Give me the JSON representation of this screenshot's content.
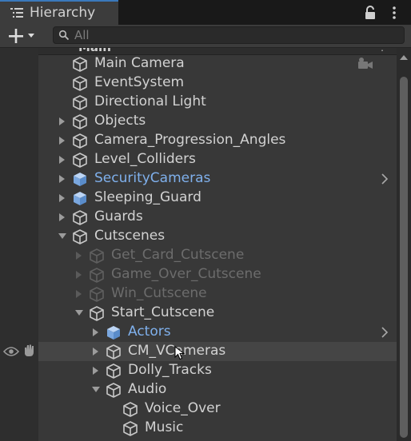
{
  "window": {
    "tab_title": "Hierarchy"
  },
  "toolbar": {
    "search_placeholder": "All"
  },
  "scene": {
    "name": "Main"
  },
  "colors": {
    "prefab_text": "#7fb0ec",
    "disabled_text": "#6c6c6c",
    "normal_text": "#d2d2d2",
    "accent": "#3a79bb"
  },
  "rows": [
    {
      "label": "Main Camera",
      "depth": 0,
      "arrow": "none",
      "icon": "gameobject-icon",
      "state": "normal"
    },
    {
      "label": "EventSystem",
      "depth": 0,
      "arrow": "none",
      "icon": "gameobject-icon",
      "state": "normal"
    },
    {
      "label": "Directional Light",
      "depth": 0,
      "arrow": "none",
      "icon": "gameobject-icon",
      "state": "normal"
    },
    {
      "label": "Objects",
      "depth": 0,
      "arrow": "collapsed",
      "icon": "gameobject-icon",
      "state": "normal"
    },
    {
      "label": "Camera_Progression_Angles",
      "depth": 0,
      "arrow": "collapsed",
      "icon": "gameobject-icon",
      "state": "normal"
    },
    {
      "label": "Level_Colliders",
      "depth": 0,
      "arrow": "collapsed",
      "icon": "gameobject-icon",
      "state": "normal"
    },
    {
      "label": "SecurityCameras",
      "depth": 0,
      "arrow": "collapsed",
      "icon": "prefab-icon",
      "state": "prefab",
      "chevron": true
    },
    {
      "label": "Sleeping_Guard",
      "depth": 0,
      "arrow": "collapsed",
      "icon": "prefab-icon",
      "state": "normal"
    },
    {
      "label": "Guards",
      "depth": 0,
      "arrow": "collapsed",
      "icon": "gameobject-icon",
      "state": "normal"
    },
    {
      "label": "Cutscenes",
      "depth": 0,
      "arrow": "expanded",
      "icon": "gameobject-icon",
      "state": "normal"
    },
    {
      "label": "Get_Card_Cutscene",
      "depth": 1,
      "arrow": "collapsed",
      "icon": "gameobject-icon",
      "state": "disabled"
    },
    {
      "label": "Game_Over_Cutscene",
      "depth": 1,
      "arrow": "collapsed",
      "icon": "gameobject-icon",
      "state": "disabled"
    },
    {
      "label": "Win_Cutscene",
      "depth": 1,
      "arrow": "collapsed",
      "icon": "gameobject-icon",
      "state": "disabled"
    },
    {
      "label": "Start_Cutscene",
      "depth": 1,
      "arrow": "expanded",
      "icon": "gameobject-icon",
      "state": "normal"
    },
    {
      "label": "Actors",
      "depth": 2,
      "arrow": "collapsed",
      "icon": "prefab-icon",
      "state": "prefab",
      "chevron": true
    },
    {
      "label": "CM_VCameras",
      "depth": 2,
      "arrow": "collapsed",
      "icon": "gameobject-icon",
      "state": "normal",
      "hover": true
    },
    {
      "label": "Dolly_Tracks",
      "depth": 2,
      "arrow": "collapsed",
      "icon": "gameobject-icon",
      "state": "normal"
    },
    {
      "label": "Audio",
      "depth": 2,
      "arrow": "expanded",
      "icon": "gameobject-icon",
      "state": "normal"
    },
    {
      "label": "Voice_Over",
      "depth": 3,
      "arrow": "none",
      "icon": "gameobject-icon",
      "state": "normal"
    },
    {
      "label": "Music",
      "depth": 3,
      "arrow": "none",
      "icon": "gameobject-icon",
      "state": "normal"
    }
  ]
}
